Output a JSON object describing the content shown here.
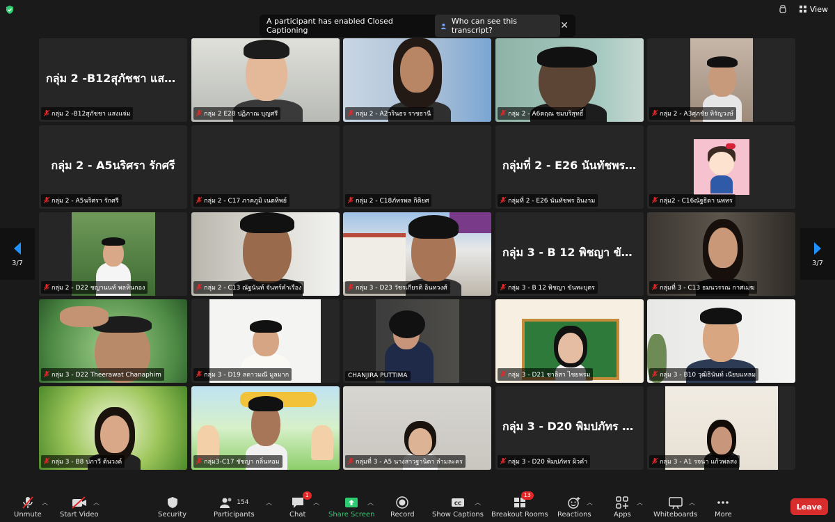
{
  "banner": {
    "message": "A participant has enabled Closed Captioning",
    "link": "Who can see this transcript?"
  },
  "view_label": "View",
  "page_indicator_left": "3/7",
  "page_indicator_right": "3/7",
  "tiles": [
    {
      "label": "กลุ่ม 2 -B12สุภัชชา แสงแจ่ม",
      "big": "กลุ่ม 2 -B12สุภัชชา แสงแ..."
    },
    {
      "label": "กลุ่ม 2 E28 ปฏิภาณ บุญศรี",
      "big": ""
    },
    {
      "label": "กลุ่ม 2 - A2วรินธร ราชธานี",
      "big": ""
    },
    {
      "label": "กลุ่ม 2 - A6ตฤณ ชมบริสุทธิ์",
      "big": ""
    },
    {
      "label": "กลุ่ม 2 - A3ศุภชัย หิรัญวงษ์",
      "big": ""
    },
    {
      "label": "กลุ่ม 2 - A5นริศรา รักศรี",
      "big": "กลุ่ม 2 - A5นริศรา รักศรี"
    },
    {
      "label": "กลุ่ม 2 - C17 ภาคภูมิ เนตทิพย์",
      "big": ""
    },
    {
      "label": "กลุ่ม 2 - C18ภัทรพล กิติยศ",
      "big": ""
    },
    {
      "label": "กลุ่มที่ 2 - E26 นันทัชพร อินงาม",
      "big": "กลุ่มที่ 2 - E26 นันทัชพร..."
    },
    {
      "label": "กลุ่ม2 - C16ณัฐธิดา นพทร",
      "big": ""
    },
    {
      "label": "กลุ่ม 2 - D22 ชญานนท์ พลหินกอง",
      "big": ""
    },
    {
      "label": "กลุ่ม 2 - C13 ณัฐนันท์ จันทร์คำเรือง",
      "big": ""
    },
    {
      "label": "กลุ่ม 3 - D23 วัชรเกียรติ อินทวงศ์",
      "big": ""
    },
    {
      "label": "กลุ่ม 3 - B 12 พิชญา ขันทะบุตร",
      "big": "กลุ่ม 3 - B 12 พิชญา ขันท..."
    },
    {
      "label": "กลุ่มที่ 3 - C13 ธมนวรรณ กาศเมฆ",
      "big": ""
    },
    {
      "label": "กลุ่ม 3 - D22 Theerawat Chanaphim",
      "big": ""
    },
    {
      "label": "กลุ่ม 3 - D19 ลดาวมณี มูลมาก",
      "big": ""
    },
    {
      "label": "CHANJIRA PUTTIMA",
      "big": ""
    },
    {
      "label": "กลุ่ม 3 - D21 ชาลิสา ไชยพรม",
      "big": ""
    },
    {
      "label": "กลุ่ม 3 - B10 วุฒิธินันท์ เนียบแหลม",
      "big": ""
    },
    {
      "label": "กลุ่ม 3 - B8 ปภาวี ต้นวงค์",
      "big": ""
    },
    {
      "label": "กลุ่ม3-C17 ชัชญา กลิ่นหอม",
      "big": ""
    },
    {
      "label": "กลุ่มที่ 3 - A5 นางสาวฐานิตา ลำมละคร",
      "big": ""
    },
    {
      "label": "กลุ่ม 3 - D20 พิมปภัทร ผิวคำ",
      "big": "กลุ่ม 3 - D20 พิมปภัทร ผิ..."
    },
    {
      "label": "กลุ่ม 3 - A1 รจนา แก้วพลสง",
      "big": ""
    }
  ],
  "toolbar": {
    "unmute": "Unmute",
    "start_video": "Start Video",
    "security": "Security",
    "participants": "Participants",
    "participants_count": "154",
    "chat": "Chat",
    "chat_badge": "1",
    "share_screen": "Share Screen",
    "record": "Record",
    "show_captions": "Show Captions",
    "breakout_rooms": "Breakout Rooms",
    "breakout_badge": "13",
    "reactions": "Reactions",
    "apps": "Apps",
    "whiteboards": "Whiteboards",
    "more": "More",
    "leave": "Leave"
  },
  "colors": {
    "background": "#1a1a1a",
    "tile": "#262626",
    "leave": "#d92c2c",
    "share_green": "#2ecc71",
    "mic_muted": "#e02828"
  }
}
